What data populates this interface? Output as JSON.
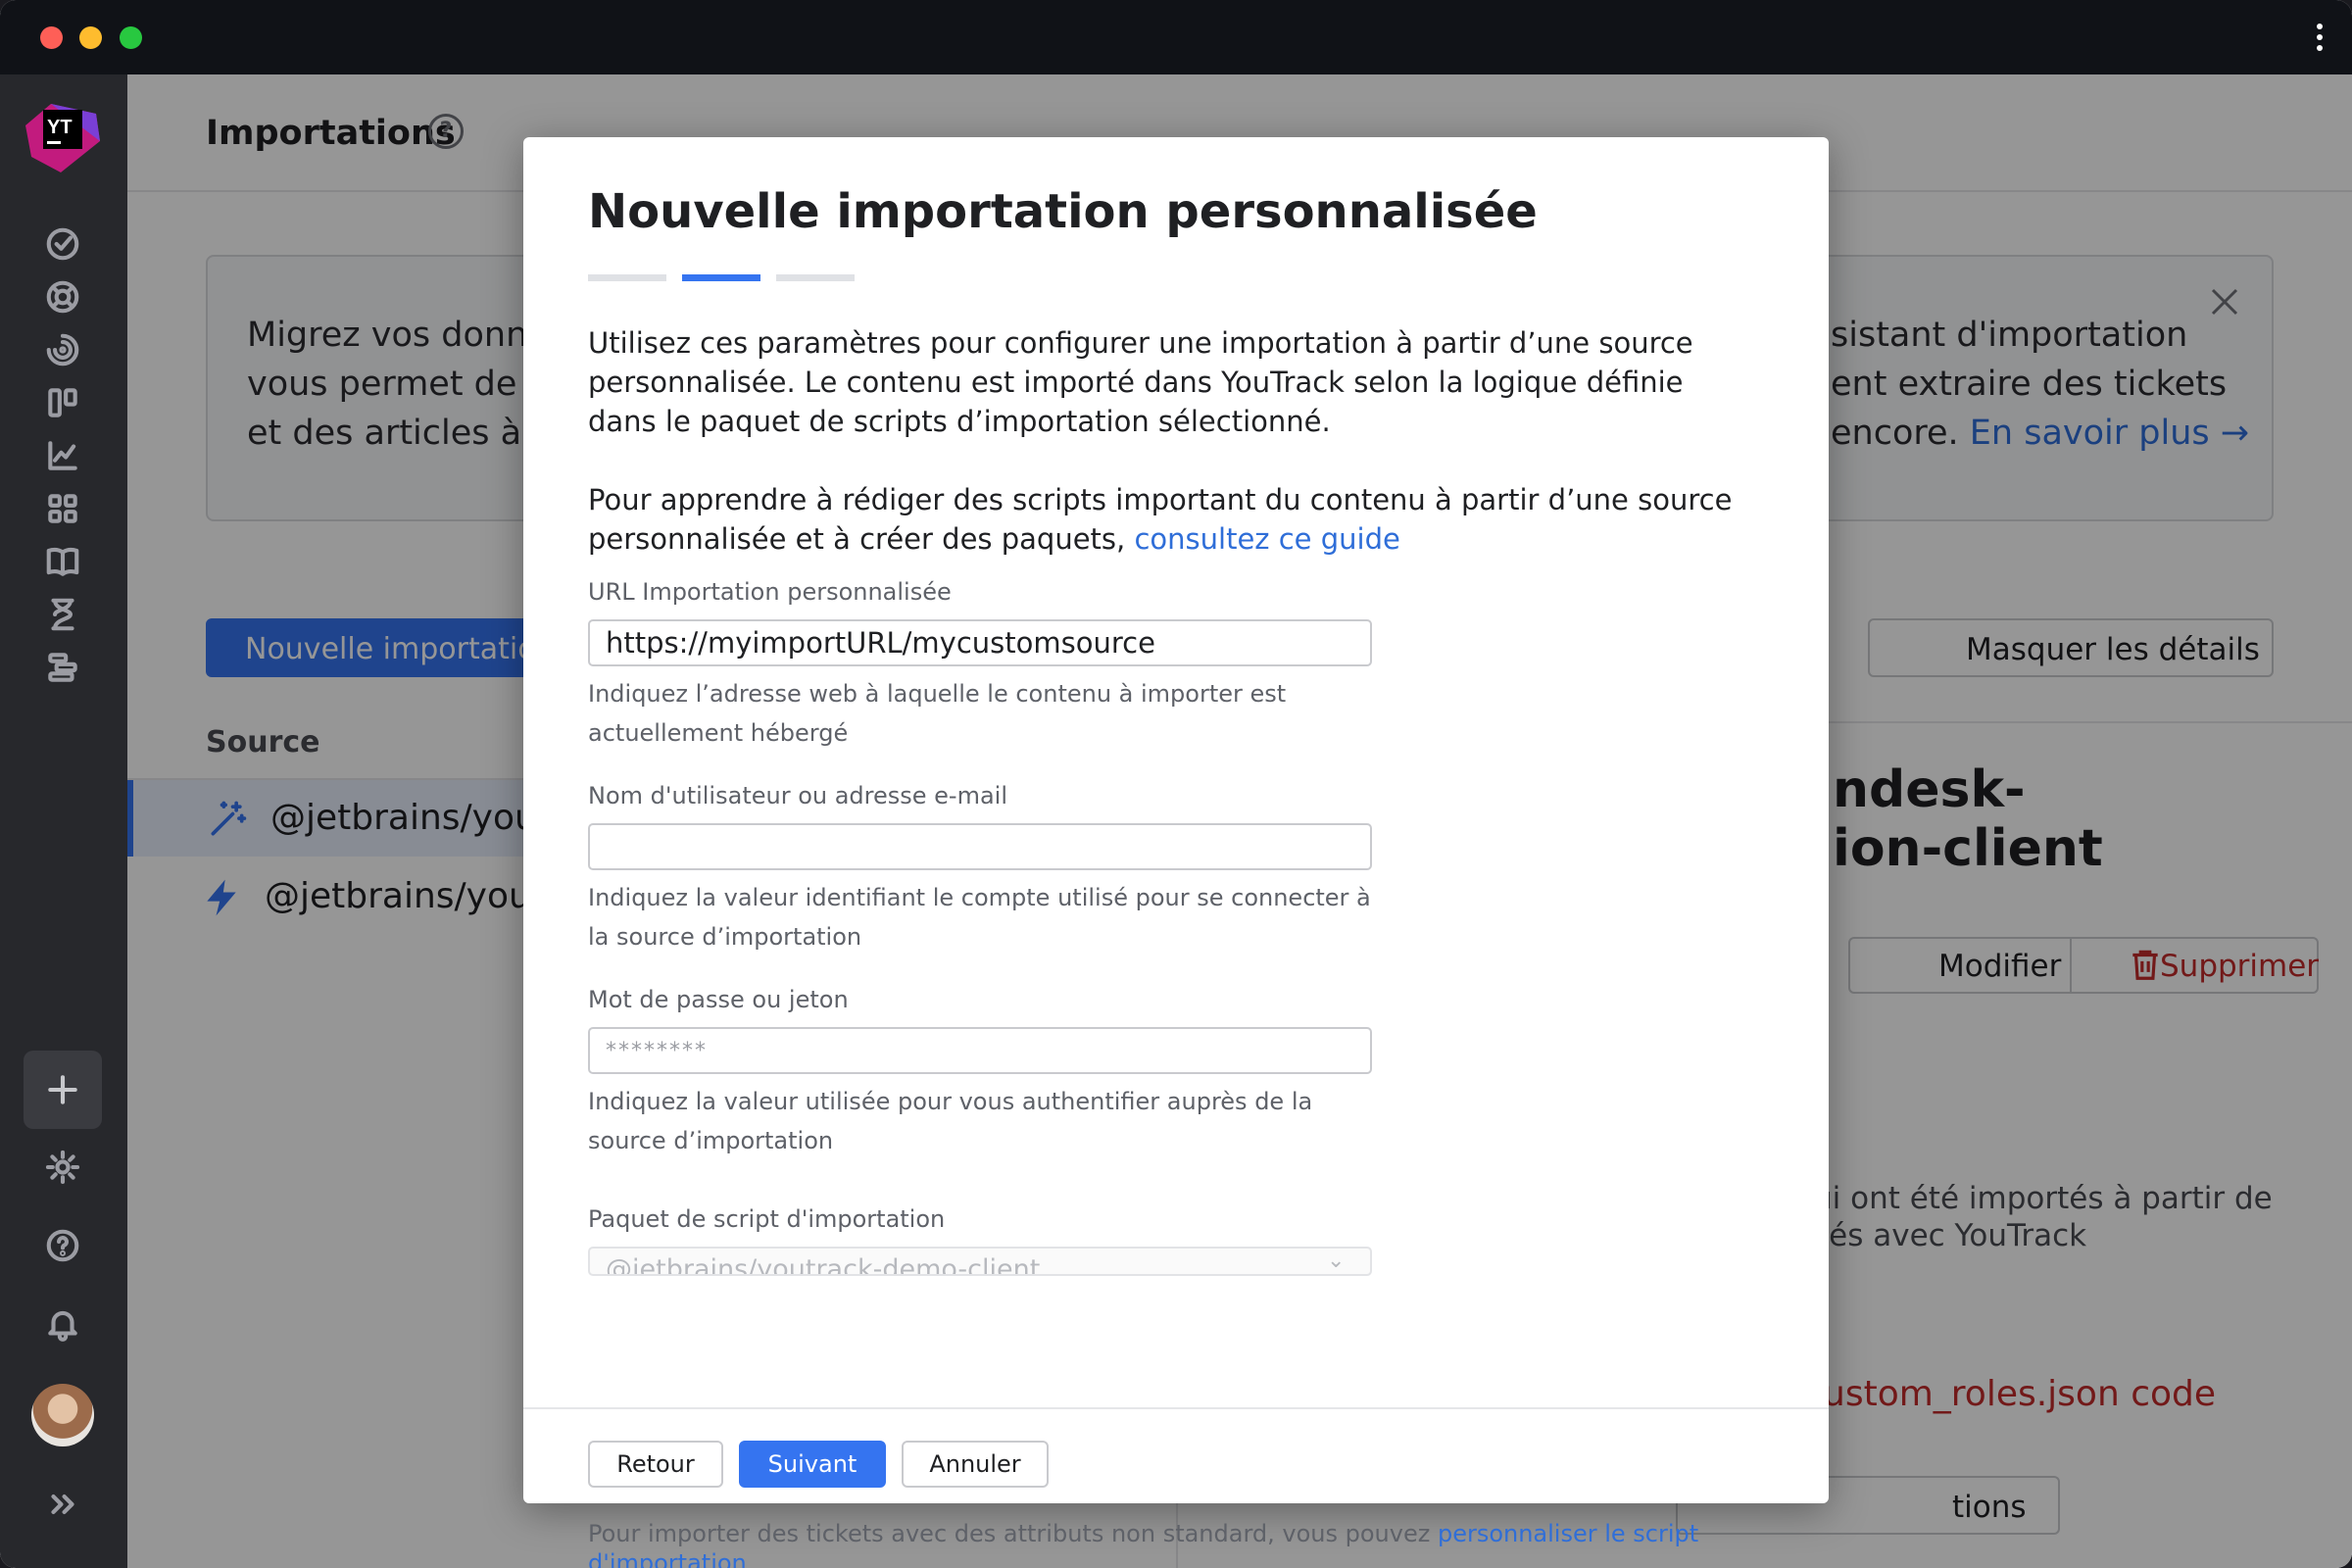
{
  "page": {
    "title": "Importations",
    "banner": {
      "line1": "Migrez vos donne",
      "line2": "vous permet de c",
      "line3": "et des articles à p",
      "line1_right": "sistant d'importation",
      "line2_right": "ent extraire des tickets",
      "line3_right": "encore. ",
      "link": "En savoir plus →"
    },
    "new_import_button": "Nouvelle importation",
    "hide_details_button": "Masquer les détails",
    "source_header": "Source",
    "sources": [
      {
        "label": "@jetbrains/yout",
        "icon": "magic-wand-icon",
        "selected": true
      },
      {
        "label": "@jetbrains/yout",
        "icon": "lightning-icon",
        "selected": false
      }
    ],
    "details_title_1": "ndesk-",
    "details_title_2": "ion-client",
    "modify_button": "Modifier",
    "delete_button": "Supprimer",
    "details_text_1": "ui ont été importés à partir de",
    "details_text_2": "sés avec YouTrack",
    "details_code": "ustom_roles.json code",
    "options_button": "tions"
  },
  "sidebar": {
    "logo": "YT",
    "icons": [
      "check-circle-icon",
      "lifebuoy-icon",
      "spiral-icon",
      "board-icon",
      "chart-icon",
      "apps-grid-icon",
      "book-icon",
      "hourglass-icon",
      "timeline-icon",
      "add-icon",
      "gear-icon",
      "help-circle-icon",
      "bell-icon",
      "avatar",
      "expand-icon"
    ]
  },
  "modal": {
    "title": "Nouvelle importation personnalisée",
    "current_step": 2,
    "total_steps": 3,
    "intro_1": "Utilisez ces paramètres pour configurer une importation à partir d’une source personnalisée. Le contenu est importé dans YouTrack selon la logique définie dans le paquet de scripts d’importation sélectionné.",
    "intro_2": "Pour apprendre à rédiger des scripts important du contenu à partir d’une source personnalisée et à créer des paquets, ",
    "guide_link": "consultez ce guide",
    "url_label": "URL Importation personnalisée",
    "url_value": "https://myimportURL/mycustomsource",
    "url_hint": "Indiquez l’adresse web à laquelle le contenu à importer est actuellement hébergé",
    "user_label": "Nom d'utilisateur ou adresse e-mail",
    "user_value": "",
    "user_hint": "Indiquez la valeur identifiant le compte utilisé pour se connecter à la source d’importation",
    "pass_label": "Mot de passe ou jeton",
    "pass_placeholder": "********",
    "pass_hint": "Indiquez la valeur utilisée pour vous authentifier auprès de la source d’importation",
    "pkg_label": "Paquet de script d'importation",
    "pkg_value": "@jetbrains/youtrack-demo-client",
    "back_button": "Retour",
    "next_button": "Suivant",
    "cancel_button": "Annuler",
    "footer_note": "Pour importer des tickets avec des attributs non standard, vous pouvez ",
    "footer_link": "personnaliser le script d'importation"
  }
}
